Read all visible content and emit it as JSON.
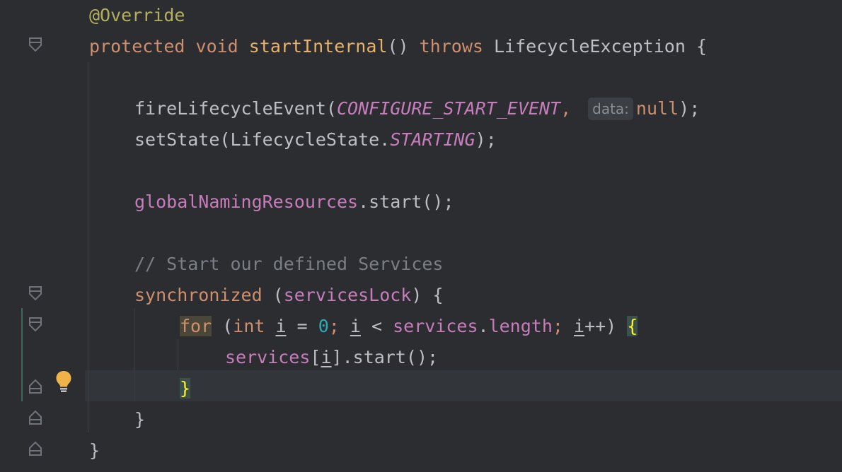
{
  "editor": {
    "lines": [
      {
        "id": "override",
        "tokens": [
          {
            "t": "@Override",
            "c": "ann"
          }
        ]
      },
      {
        "id": "method-sig",
        "tokens": [
          {
            "t": "protected ",
            "c": "kw"
          },
          {
            "t": "void ",
            "c": "kw"
          },
          {
            "t": "startInternal",
            "c": "method-def"
          },
          {
            "t": "() ",
            "c": "plain"
          },
          {
            "t": "throws ",
            "c": "kw"
          },
          {
            "t": "LifecycleException {",
            "c": "plain"
          }
        ]
      },
      {
        "id": "blank1",
        "tokens": []
      },
      {
        "id": "fire-event",
        "tokens": [
          {
            "t": "fireLifecycleEvent(",
            "c": "plain"
          },
          {
            "t": "CONFIGURE_START_EVENT",
            "c": "static"
          },
          {
            "t": ",",
            "c": "kw"
          },
          {
            "hint": "data:"
          },
          {
            "t": "null",
            "c": "kw"
          },
          {
            "t": ");",
            "c": "plain"
          }
        ]
      },
      {
        "id": "set-state",
        "tokens": [
          {
            "t": "setState(LifecycleState.",
            "c": "plain"
          },
          {
            "t": "STARTING",
            "c": "static"
          },
          {
            "t": ");",
            "c": "plain"
          }
        ]
      },
      {
        "id": "blank2",
        "tokens": []
      },
      {
        "id": "global-naming",
        "tokens": [
          {
            "t": "globalNamingResources",
            "c": "field"
          },
          {
            "t": ".start();",
            "c": "plain"
          }
        ]
      },
      {
        "id": "blank3",
        "tokens": []
      },
      {
        "id": "comment",
        "tokens": [
          {
            "t": "// Start our defined Services",
            "c": "comment"
          }
        ]
      },
      {
        "id": "synchronized",
        "tokens": [
          {
            "t": "synchronized ",
            "c": "kw"
          },
          {
            "t": "(",
            "c": "plain"
          },
          {
            "t": "servicesLock",
            "c": "field"
          },
          {
            "t": ") {",
            "c": "plain"
          }
        ]
      },
      {
        "id": "for-loop",
        "tokens": [
          {
            "t": "for",
            "c": "kw hl-for"
          },
          {
            "t": " (",
            "c": "plain"
          },
          {
            "t": "int ",
            "c": "kw"
          },
          {
            "t": "i",
            "c": "plain under"
          },
          {
            "t": " = ",
            "c": "plain"
          },
          {
            "t": "0",
            "c": "num"
          },
          {
            "t": "; ",
            "c": "kw"
          },
          {
            "t": "i",
            "c": "plain under"
          },
          {
            "t": " < ",
            "c": "plain"
          },
          {
            "t": "services",
            "c": "field"
          },
          {
            "t": ".",
            "c": "plain"
          },
          {
            "t": "length",
            "c": "field"
          },
          {
            "t": "; ",
            "c": "kw"
          },
          {
            "t": "i",
            "c": "plain under"
          },
          {
            "t": "++) ",
            "c": "plain"
          },
          {
            "t": "{",
            "c": "hl-brace"
          }
        ]
      },
      {
        "id": "services-start",
        "tokens": [
          {
            "t": "services",
            "c": "field"
          },
          {
            "t": "[",
            "c": "plain"
          },
          {
            "t": "i",
            "c": "plain under"
          },
          {
            "t": "].start();",
            "c": "plain"
          }
        ]
      },
      {
        "id": "for-close",
        "tokens": [
          {
            "t": "}",
            "c": "hl-brace"
          }
        ]
      },
      {
        "id": "sync-close",
        "tokens": [
          {
            "t": "}",
            "c": "plain"
          }
        ]
      },
      {
        "id": "method-close",
        "tokens": [
          {
            "t": "}",
            "c": "plain"
          }
        ]
      }
    ]
  },
  "gutter": {
    "fold_markers": [
      "method-sig",
      "synchronized",
      "for-loop",
      "for-close",
      "sync-close",
      "method-close"
    ],
    "intention_icon": "lightbulb-icon"
  },
  "colors": {
    "background": "#2b2d30",
    "keyword": "#cf8e6d",
    "annotation": "#b3ae60",
    "method_declaration": "#e8b26a",
    "field": "#c77dbb",
    "number": "#2aacb8",
    "comment": "#7a7e85",
    "text": "#bcbec4"
  }
}
